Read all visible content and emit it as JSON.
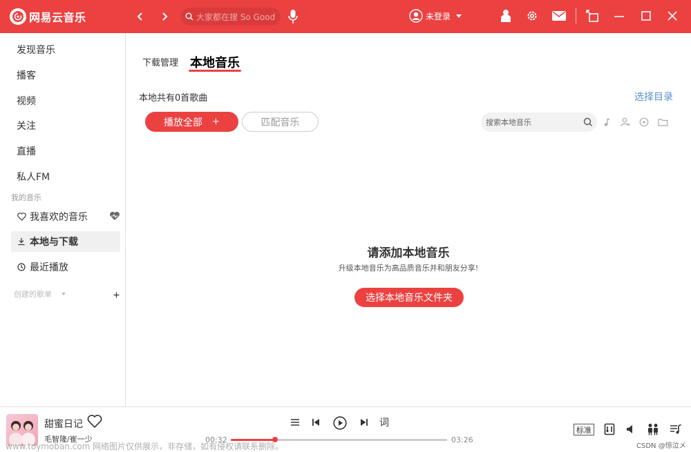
{
  "app": {
    "title": "网易云音乐"
  },
  "header": {
    "search_placeholder": "大家都在搜 So Good",
    "user_label": "未登录"
  },
  "sidebar": {
    "items": [
      {
        "label": "发现音乐"
      },
      {
        "label": "播客"
      },
      {
        "label": "视频"
      },
      {
        "label": "关注"
      },
      {
        "label": "直播"
      },
      {
        "label": "私人FM"
      }
    ],
    "my_music_title": "我的音乐",
    "my_music": [
      {
        "label": "我喜欢的音乐",
        "icon": "heart-icon"
      },
      {
        "label": "本地与下载",
        "icon": "download-icon",
        "active": true
      },
      {
        "label": "最近播放",
        "icon": "clock-icon"
      }
    ],
    "created_playlists_title": "创建的歌单"
  },
  "main": {
    "tabs": [
      {
        "label": "下载管理"
      },
      {
        "label": "本地音乐",
        "active": true
      }
    ],
    "count_label": "本地共有0首歌曲",
    "choose_dir": "选择目录",
    "play_all": "播放全部",
    "play_all_plus": "+",
    "match_music": "匹配音乐",
    "local_search_placeholder": "搜索本地音乐",
    "empty": {
      "title": "请添加本地音乐",
      "subtitle": "升级本地音乐为高品质音乐并和朋友分享!",
      "button": "选择本地音乐文件夹"
    }
  },
  "player": {
    "song_title": "甜蜜日记",
    "artist": "毛智隆/崔一少",
    "current_time": "00:32",
    "total_time": "03:26",
    "progress": 0.205,
    "lyric_button": "词",
    "quality": "标准"
  },
  "overlay": {
    "watermark": "www.toymoban.com 网络图片仅供展示，非存储，如有侵权请联系删除。",
    "credit": "CSDN @惊泣メ"
  },
  "colors": {
    "accent": "#ec4141",
    "link": "#5b8fd1"
  }
}
